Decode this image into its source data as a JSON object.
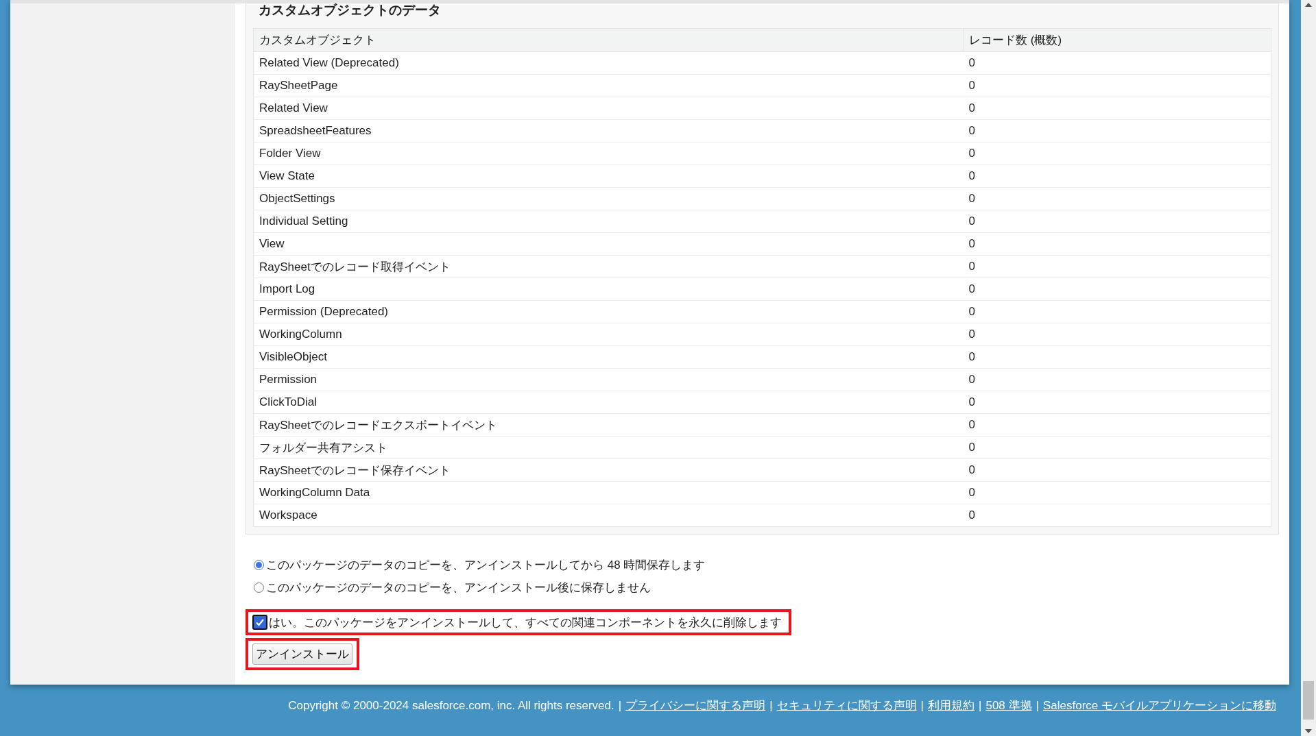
{
  "section": {
    "title": "カスタムオブジェクトのデータ",
    "table": {
      "columns": [
        "カスタムオブジェクト",
        "レコード数 (概数)"
      ],
      "rows": [
        {
          "object": "Related View (Deprecated)",
          "records": "0"
        },
        {
          "object": "RaySheetPage",
          "records": "0"
        },
        {
          "object": "Related View",
          "records": "0"
        },
        {
          "object": "SpreadsheetFeatures",
          "records": "0"
        },
        {
          "object": "Folder View",
          "records": "0"
        },
        {
          "object": "View State",
          "records": "0"
        },
        {
          "object": "ObjectSettings",
          "records": "0"
        },
        {
          "object": "Individual Setting",
          "records": "0"
        },
        {
          "object": "View",
          "records": "0"
        },
        {
          "object": "RaySheetでのレコード取得イベント",
          "records": "0"
        },
        {
          "object": "Import Log",
          "records": "0"
        },
        {
          "object": "Permission (Deprecated)",
          "records": "0"
        },
        {
          "object": "WorkingColumn",
          "records": "0"
        },
        {
          "object": "VisibleObject",
          "records": "0"
        },
        {
          "object": "Permission",
          "records": "0"
        },
        {
          "object": "ClickToDial",
          "records": "0"
        },
        {
          "object": "RaySheetでのレコードエクスポートイベント",
          "records": "0"
        },
        {
          "object": "フォルダー共有アシスト",
          "records": "0"
        },
        {
          "object": "RaySheetでのレコード保存イベント",
          "records": "0"
        },
        {
          "object": "WorkingColumn Data",
          "records": "0"
        },
        {
          "object": "Workspace",
          "records": "0"
        }
      ]
    }
  },
  "retention_options": [
    {
      "label": "このパッケージのデータのコピーを、アンインストールしてから 48 時間保存します",
      "selected": true
    },
    {
      "label": "このパッケージのデータのコピーを、アンインストール後に保存しません",
      "selected": false
    }
  ],
  "confirm": {
    "label": "はい。このパッケージをアンインストールして、すべての関連コンポーネントを永久に削除します",
    "checked": true,
    "highlighted": true
  },
  "uninstall_button": {
    "label": "アンインストール",
    "highlighted": true
  },
  "footer": [
    {
      "kind": "text",
      "text": "Copyright © 2000-2024 salesforce.com, inc. All rights reserved."
    },
    {
      "kind": "separator",
      "text": "|"
    },
    {
      "kind": "link",
      "text": "プライバシーに関する声明"
    },
    {
      "kind": "separator",
      "text": "|"
    },
    {
      "kind": "link",
      "text": "セキュリティに関する声明"
    },
    {
      "kind": "separator",
      "text": "|"
    },
    {
      "kind": "link",
      "text": "利用規約"
    },
    {
      "kind": "separator",
      "text": "|"
    },
    {
      "kind": "link",
      "text": "508 準拠"
    },
    {
      "kind": "separator",
      "text": "|"
    },
    {
      "kind": "link",
      "text": "Salesforce モバイルアプリケーションに移動"
    }
  ]
}
